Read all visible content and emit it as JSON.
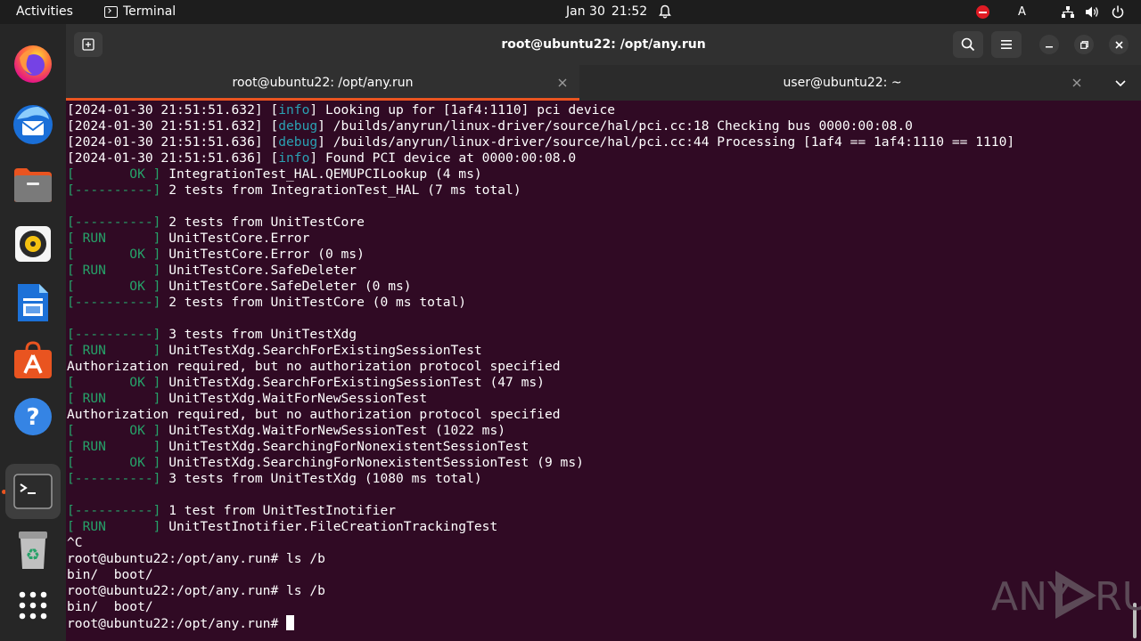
{
  "topbar": {
    "activities": "Activities",
    "app_name": "Terminal",
    "date": "Jan 30",
    "time": "21:52",
    "keyboard_layout": "A"
  },
  "dock": {
    "items": [
      {
        "name": "Firefox",
        "icon": "firefox-icon"
      },
      {
        "name": "Thunderbird",
        "icon": "thunderbird-icon"
      },
      {
        "name": "Files",
        "icon": "files-icon"
      },
      {
        "name": "Rhythmbox",
        "icon": "rhythmbox-icon"
      },
      {
        "name": "LibreOffice Writer",
        "icon": "writer-icon"
      },
      {
        "name": "Ubuntu Software",
        "icon": "software-icon"
      },
      {
        "name": "Help",
        "icon": "help-icon"
      },
      {
        "name": "Terminal",
        "icon": "terminal-icon"
      },
      {
        "name": "Trash",
        "icon": "trash-icon"
      },
      {
        "name": "Show Applications",
        "icon": "apps-grid-icon"
      }
    ]
  },
  "window": {
    "title": "root@ubuntu22: /opt/any.run",
    "tabs": [
      {
        "label": "root@ubuntu22: /opt/any.run",
        "active": true
      },
      {
        "label": "user@ubuntu22: ~",
        "active": false
      }
    ]
  },
  "terminal": {
    "lines": [
      {
        "t": "[2024-01-30 21:51:51.632] [",
        "lvl": "info",
        "rest": "] Looking up for [1af4:1110] pci device"
      },
      {
        "t": "[2024-01-30 21:51:51.632] [",
        "lvl": "debug",
        "rest": "] /builds/anyrun/linux-driver/source/hal/pci.cc:18 Checking bus 0000:00:08.0"
      },
      {
        "t": "[2024-01-30 21:51:51.636] [",
        "lvl": "debug",
        "rest": "] /builds/anyrun/linux-driver/source/hal/pci.cc:44 Processing [1af4 == 1af4:1110 == 1110]"
      },
      {
        "t": "[2024-01-30 21:51:51.636] [",
        "lvl": "info",
        "rest": "] Found PCI device at 0000:00:08.0"
      },
      {
        "tag": "[       OK ]",
        "rest": " IntegrationTest_HAL.QEMUPCILookup (4 ms)"
      },
      {
        "tag": "[----------]",
        "rest": " 2 tests from IntegrationTest_HAL (7 ms total)"
      },
      {
        "rest": ""
      },
      {
        "tag": "[----------]",
        "rest": " 2 tests from UnitTestCore"
      },
      {
        "tag": "[ RUN      ]",
        "rest": " UnitTestCore.Error"
      },
      {
        "tag": "[       OK ]",
        "rest": " UnitTestCore.Error (0 ms)"
      },
      {
        "tag": "[ RUN      ]",
        "rest": " UnitTestCore.SafeDeleter"
      },
      {
        "tag": "[       OK ]",
        "rest": " UnitTestCore.SafeDeleter (0 ms)"
      },
      {
        "tag": "[----------]",
        "rest": " 2 tests from UnitTestCore (0 ms total)"
      },
      {
        "rest": ""
      },
      {
        "tag": "[----------]",
        "rest": " 3 tests from UnitTestXdg"
      },
      {
        "tag": "[ RUN      ]",
        "rest": " UnitTestXdg.SearchForExistingSessionTest"
      },
      {
        "rest": "Authorization required, but no authorization protocol specified"
      },
      {
        "tag": "[       OK ]",
        "rest": " UnitTestXdg.SearchForExistingSessionTest (47 ms)"
      },
      {
        "tag": "[ RUN      ]",
        "rest": " UnitTestXdg.WaitForNewSessionTest"
      },
      {
        "rest": "Authorization required, but no authorization protocol specified"
      },
      {
        "tag": "[       OK ]",
        "rest": " UnitTestXdg.WaitForNewSessionTest (1022 ms)"
      },
      {
        "tag": "[ RUN      ]",
        "rest": " UnitTestXdg.SearchingForNonexistentSessionTest"
      },
      {
        "tag": "[       OK ]",
        "rest": " UnitTestXdg.SearchingForNonexistentSessionTest (9 ms)"
      },
      {
        "tag": "[----------]",
        "rest": " 3 tests from UnitTestXdg (1080 ms total)"
      },
      {
        "rest": ""
      },
      {
        "tag": "[----------]",
        "rest": " 1 test from UnitTestInotifier"
      },
      {
        "tag": "[ RUN      ]",
        "rest": " UnitTestInotifier.FileCreationTrackingTest"
      },
      {
        "rest": "^C"
      },
      {
        "rest": "root@ubuntu22:/opt/any.run# ls /b"
      },
      {
        "rest": "bin/  boot/"
      },
      {
        "rest": "root@ubuntu22:/opt/any.run# ls /b"
      },
      {
        "rest": "bin/  boot/"
      },
      {
        "rest": "root@ubuntu22:/opt/any.run# ",
        "cursor": true
      }
    ]
  },
  "watermark": {
    "left": "ANY",
    "right": "RUN"
  },
  "colors": {
    "terminal_bg": "#300a24",
    "ok_green": "#26a269",
    "log_level_cyan": "#2aa1b3",
    "accent_orange": "#e95420"
  }
}
